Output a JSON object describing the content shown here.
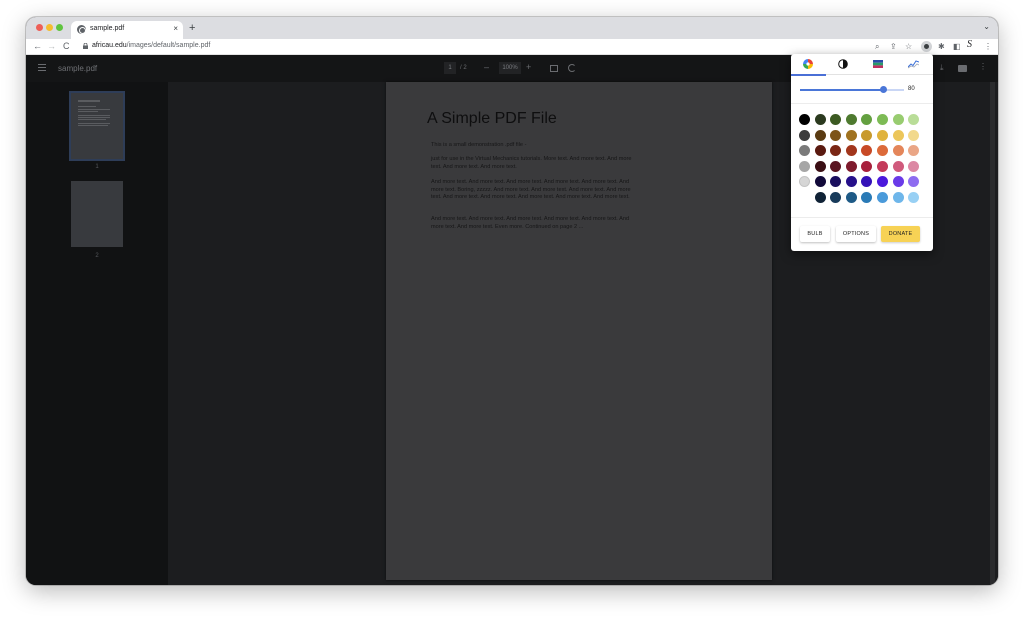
{
  "browser": {
    "tab": {
      "title": "sample.pdf",
      "close": "×"
    },
    "new_tab": "+",
    "tab_menu": "⌄",
    "nav": {
      "back": "←",
      "forward": "→",
      "reload": "C"
    },
    "address": {
      "host": "africau.edu",
      "path": "/images/default/sample.pdf"
    },
    "toolbar_icons": {
      "zoom": "⌕",
      "share": "⇪",
      "bookmark": "☆",
      "extensions": "✱",
      "sidebar": "◧",
      "profile": "S",
      "menu": "⋮"
    }
  },
  "pdf_viewer": {
    "file_name": "sample.pdf",
    "current_page": "1",
    "page_separator": "/ 2",
    "zoom_minus": "–",
    "zoom_level": "100%",
    "zoom_plus": "+",
    "download_icon": "⤓",
    "more_icon": "⋮",
    "thumbnails": [
      {
        "number": "1"
      },
      {
        "number": "2"
      }
    ],
    "page": {
      "title": "A Simple PDF File",
      "paragraphs": [
        "This is a small demonstration .pdf file -",
        "just for use in the Virtual Mechanics tutorials. More text. And more text. And more text. And more text. And more text.",
        "And more text. And more text. And more text. And more text. And more text. And more text. Boring, zzzzz. And more text. And more text. And more text. And more text. And more text. And more text. And more text. And more text. And more text.",
        "And more text. And more text. And more text. And more text. And more text. And more text. And more text. Even more. Continued on page 2 ..."
      ]
    }
  },
  "extension_popup": {
    "tabs": [
      {
        "name": "color-mode-tab",
        "icon": "palette-icon",
        "active": true
      },
      {
        "name": "contrast-tab",
        "icon": "contrast-icon",
        "active": false
      },
      {
        "name": "theme-tab",
        "icon": "swatch-icon",
        "active": false
      },
      {
        "name": "graph-tab",
        "icon": "graph-icon",
        "active": false
      }
    ],
    "slider": {
      "value": 80,
      "label": "80"
    },
    "colors": [
      [
        "#000000",
        "#2b3a1f",
        "#3c5a22",
        "#4e7a2f",
        "#64a040",
        "#7dbb55",
        "#98cc70",
        "#b9dd98"
      ],
      [
        "#3c3c3c",
        "#5a3b12",
        "#7c5418",
        "#a0721f",
        "#c89a2c",
        "#e0b33c",
        "#ecc65a",
        "#f2d98c"
      ],
      [
        "#7a7a7a",
        "#5a1a10",
        "#7a2614",
        "#a2361c",
        "#c84a26",
        "#dc6a3a",
        "#e4865a",
        "#eaa686"
      ],
      [
        "#a6a6a6",
        "#3a0e14",
        "#5a1420",
        "#7e1a2c",
        "#a8203c",
        "#c43a5a",
        "#d05a7c",
        "#dc88a4"
      ],
      [
        "#d6d6d6",
        "#120a3a",
        "#1a0e5e",
        "#26108a",
        "#3412b8",
        "#4a18dc",
        "#6a3ae8",
        "#8e6cf0"
      ],
      [
        null,
        "#102236",
        "#183a5a",
        "#1e5a86",
        "#2a7ab6",
        "#4a9ada",
        "#6eb6ea",
        "#98d0f4"
      ]
    ],
    "buttons": {
      "bulb": "BULB",
      "options": "OPTIONS",
      "donate": "DONATE"
    }
  }
}
